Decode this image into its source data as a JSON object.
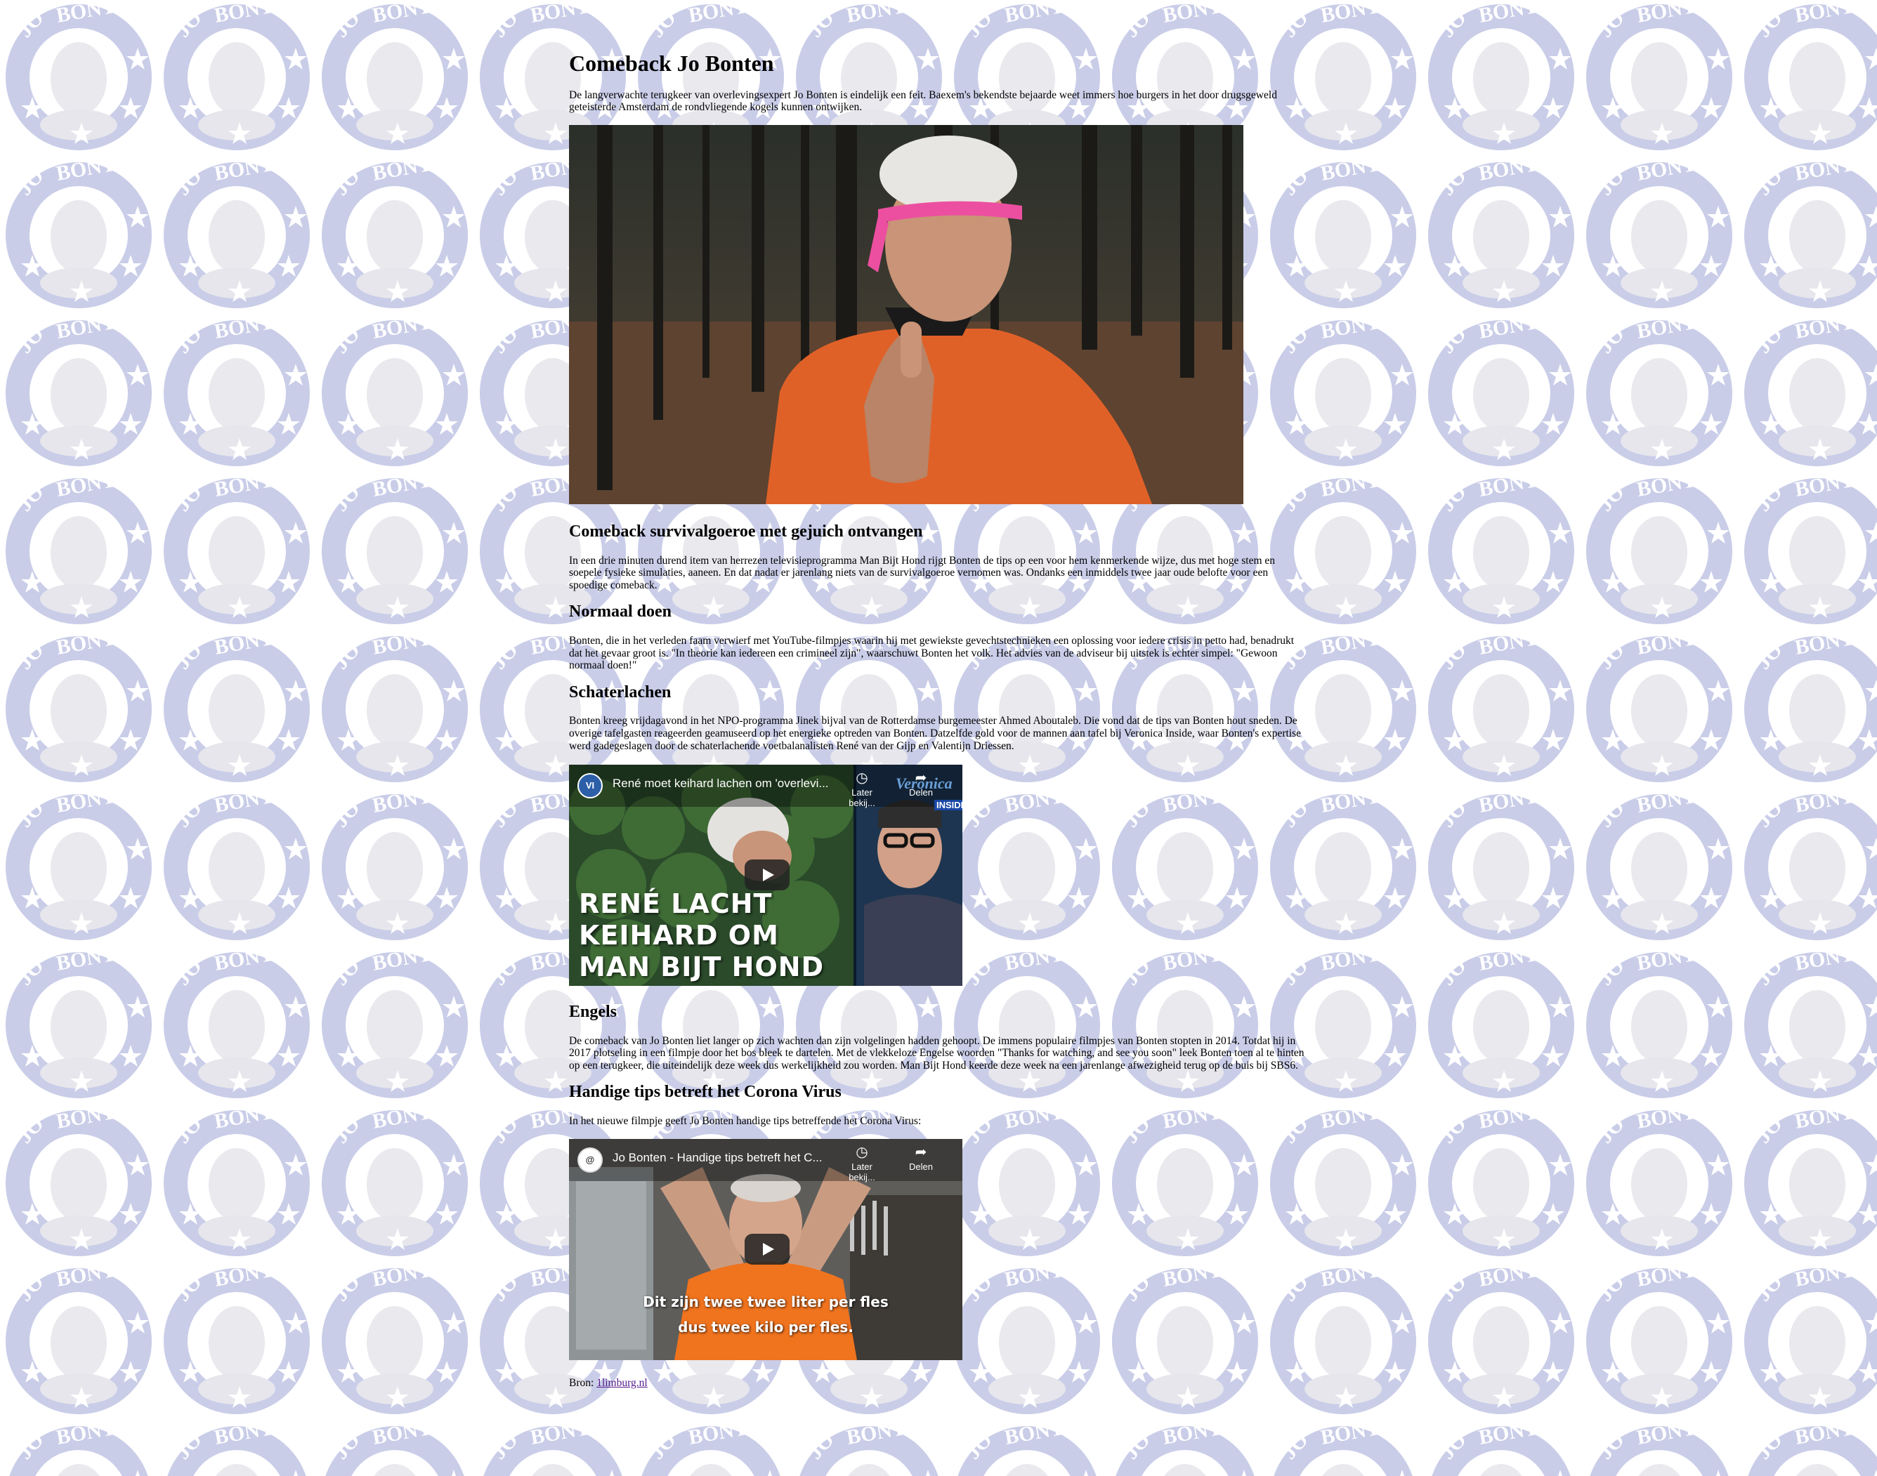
{
  "article": {
    "title": "Comeback Jo Bonten",
    "intro": "De langverwachte terugkeer van overlevingsexpert Jo Bonten is eindelijk een feit. Baexem's bekendste bejaarde weet immers hoe burgers in het door drugsgeweld geteisterde Amsterdam de rondvliegende kogels kunnen ontwijken.",
    "sections": [
      {
        "heading": "Comeback survivalgoeroe met gejuich ontvangen",
        "text": "In een drie minuten durend item van herrezen televisieprogramma Man Bijt Hond rijgt Bonten de tips op een voor hem kenmerkende wijze, dus met hoge stem en soepele fysieke simulaties, aaneen. En dat nadat er jarenlang niets van de survivalgoeroe vernomen was. Ondanks een inmiddels twee jaar oude belofte voor een spoedige comeback."
      },
      {
        "heading": "Normaal doen",
        "text": "Bonten, die in het verleden faam verwierf met YouTube-filmpjes waarin hij met gewiekste gevechtstechnieken een oplossing voor iedere crisis in petto had, benadrukt dat het gevaar groot is. \"In theorie kan iedereen een crimineel zijn\", waarschuwt Bonten het volk. Het advies van de adviseur bij uitstek is echter simpel: \"Gewoon normaal doen!\""
      },
      {
        "heading": "Schaterlachen",
        "text": "Bonten kreeg vrijdagavond in het NPO-programma Jinek bijval van de Rotterdamse burgemeester Ahmed Aboutaleb. Die vond dat de tips van Bonten hout sneden. De overige tafelgasten reageerden geamuseerd op het energieke optreden van Bonten. Datzelfde gold voor de mannen aan tafel bij Veronica Inside, waar Bonten's expertise werd gadegeslagen door de schaterlachende voetbalanalisten René van der Gijp en Valentijn Driessen."
      },
      {
        "heading": "Engels",
        "text": "De comeback van Jo Bonten liet langer op zich wachten dan zijn volgelingen hadden gehoopt. De immens populaire filmpjes van Bonten stopten in 2014. Totdat hij in 2017 plotseling in een filmpje door het bos bleek te dartelen. Met de vlekkeloze Engelse woorden \"Thanks for watching, and see you soon\" leek Bonten toen al te hinten op een terugkeer, die uiteindelijk deze week dus werkelijkheid zou worden. Man Bijt Hond keerde deze week na een jarenlange afwezigheid terug op de buis bij SBS6."
      },
      {
        "heading": "Handige tips betreft het Corona Virus",
        "text": "In het nieuwe filmpje geeft Jo Bonten handige tips betreffende het Corona Virus:"
      }
    ],
    "video1": {
      "title": "René moet keihard lachen om 'overlevi...",
      "watch_later": "Later bekij...",
      "share": "Delen",
      "caption": [
        "RENÉ LACHT",
        "KEIHARD OM",
        "MAN BIJT HOND"
      ],
      "channel_badge": "VI",
      "brand_name": "Veronica",
      "brand_sub": "INSIDE"
    },
    "video2": {
      "title": "Jo Bonten - Handige tips betreft het C...",
      "watch_later": "Later bekij...",
      "share": "Delen",
      "caption": [
        "Dit zijn twee twee liter per fles",
        "dus twee kilo per fles."
      ],
      "channel_badge": "@"
    },
    "source": {
      "label": "Bron:",
      "link_text": "1limburg.nl"
    }
  },
  "background": {
    "badge_text": "JO BONTEN",
    "ring_color": "#c9cde8",
    "star_color": "#ffffff"
  },
  "icons": {
    "clock": "clock-icon",
    "share": "share-icon",
    "play": "play-icon"
  }
}
